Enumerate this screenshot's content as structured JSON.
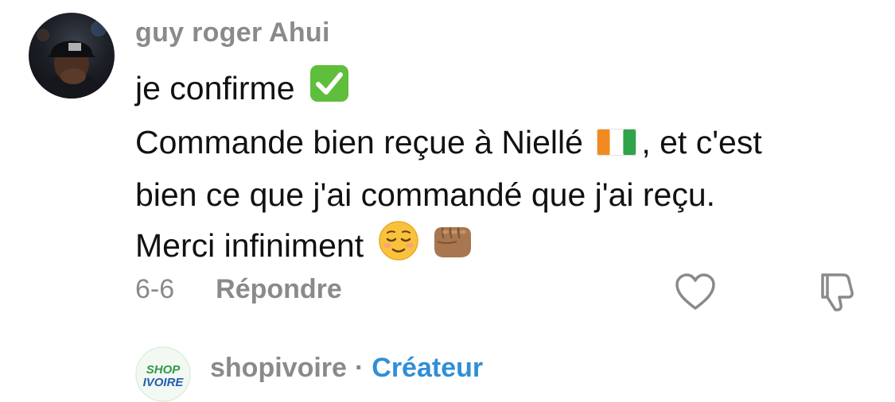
{
  "comment": {
    "username": "guy roger Ahui",
    "lines": [
      "je confirme",
      "Commande bien reçue à Niellé",
      ", et c'est",
      "bien ce que j'ai commandé que j'ai reçu.",
      "Merci infiniment"
    ],
    "date": "6-6",
    "reply_label": "Répondre",
    "icons": {
      "check": "check-mark-button-emoji",
      "flag": "ivory-coast-flag-emoji",
      "relieved": "relieved-face-emoji",
      "fist": "oncoming-fist-emoji",
      "like": "heart-outline-icon",
      "dislike": "thumbs-down-outline-icon"
    }
  },
  "reply_preview": {
    "username": "shopivoire",
    "separator": "·",
    "badge": "Créateur",
    "avatar_text": [
      "SHOP",
      "IVOIRE"
    ],
    "badge_color": "#2f8fd6"
  }
}
